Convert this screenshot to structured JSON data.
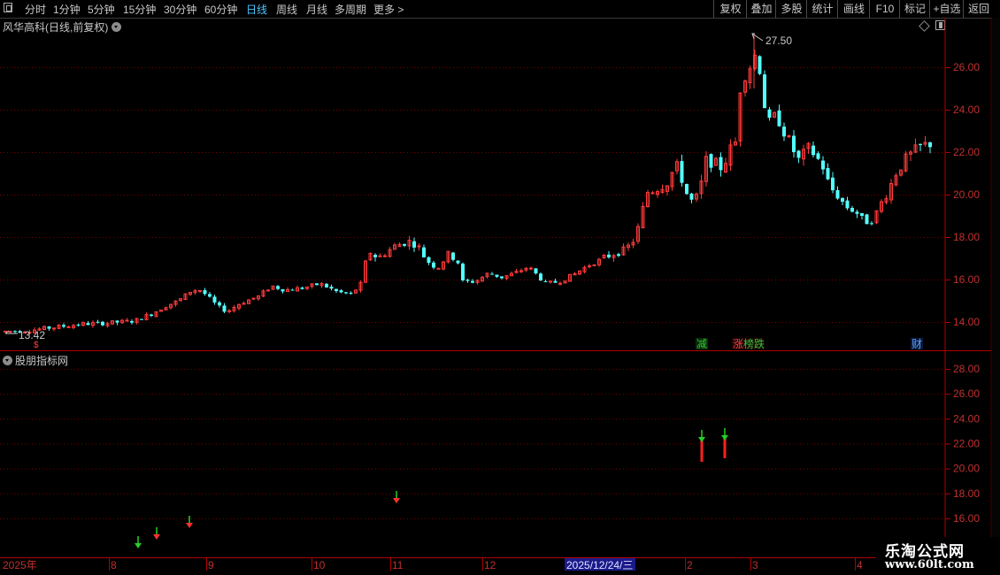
{
  "toolbar": {
    "periods": [
      "分时",
      "1分钟",
      "5分钟",
      "15分钟",
      "30分钟",
      "60分钟",
      "日线",
      "周线",
      "月线",
      "多周期",
      "更多 >"
    ],
    "active_period": "日线",
    "buttons": [
      "复权",
      "叠加",
      "多股",
      "统计",
      "画线",
      "F10",
      "标记",
      "+自选",
      "返回"
    ]
  },
  "main_chart": {
    "title": "风华高科(日线,前复权)",
    "high_label": "27.50",
    "low_label": "13.42",
    "axis_ticks": [
      "26.00",
      "24.00",
      "22.00",
      "20.00",
      "18.00",
      "16.00",
      "14.00"
    ],
    "event_markers": [
      {
        "text": "减",
        "color": "#35c435"
      },
      {
        "text": "涨",
        "color": "#ff4040"
      },
      {
        "text": "榜",
        "color": "#35c435"
      },
      {
        "text": "跌",
        "color": "#35c435"
      },
      {
        "text": "财",
        "color": "#5aa0ff"
      }
    ],
    "small_marker": "$"
  },
  "indicator_panel": {
    "title": "股朋指标网",
    "axis_ticks": [
      "28.00",
      "26.00",
      "24.00",
      "22.00",
      "20.00",
      "18.00",
      "16.00"
    ]
  },
  "time_axis": {
    "labels": [
      "2025年",
      "8",
      "9",
      "10",
      "11",
      "12",
      "2025/12/24/三",
      "2",
      "3",
      "4"
    ],
    "highlight": "2025/12/24/三"
  },
  "watermark": {
    "line1": "乐淘公式网",
    "line2": "www.60lt.com"
  },
  "colors": {
    "up": "#ff3a3a",
    "down": "#54ffff",
    "grid": "#7a0000",
    "axis": "#b00000",
    "arrow_green": "#25d025"
  },
  "chart_data": {
    "type": "candlestick",
    "ylim": [
      12.8,
      28.0
    ],
    "candles": [
      [
        13.5,
        13.62,
        13.58,
        13.46
      ],
      [
        13.55,
        13.66,
        13.6,
        13.52
      ],
      [
        13.58,
        13.7,
        13.62,
        13.55
      ],
      [
        13.62,
        13.74,
        13.66,
        13.58
      ],
      [
        13.66,
        13.78,
        13.7,
        13.62
      ],
      [
        13.7,
        13.82,
        13.74,
        13.66
      ],
      [
        13.74,
        13.86,
        13.78,
        13.7
      ],
      [
        13.78,
        13.9,
        13.82,
        13.74
      ],
      [
        13.82,
        13.94,
        13.86,
        13.78
      ],
      [
        13.86,
        13.98,
        13.9,
        13.82
      ],
      [
        13.9,
        14.02,
        13.94,
        13.86
      ],
      [
        13.94,
        14.06,
        13.98,
        13.9
      ],
      [
        13.98,
        14.1,
        14.02,
        13.94
      ],
      [
        14.02,
        14.14,
        14.06,
        13.98
      ],
      [
        14.06,
        14.18,
        14.1,
        14.02
      ],
      [
        14.1,
        14.22,
        14.14,
        14.06
      ],
      [
        14.14,
        14.26,
        14.18,
        14.1
      ],
      [
        14.18,
        14.3,
        14.22,
        14.14
      ],
      [
        14.22,
        14.34,
        14.26,
        14.18
      ],
      [
        14.26,
        14.38,
        14.3,
        14.22
      ],
      [
        14.3,
        14.42,
        14.34,
        14.26
      ],
      [
        14.34,
        14.46,
        14.38,
        14.3
      ],
      [
        14.38,
        14.5,
        14.42,
        14.34
      ],
      [
        14.42,
        14.54,
        14.46,
        14.38
      ],
      [
        14.46,
        14.58,
        14.5,
        14.42
      ],
      [
        14.5,
        14.62,
        14.54,
        14.46
      ],
      [
        14.54,
        14.66,
        14.58,
        14.5
      ],
      [
        14.58,
        14.7,
        14.62,
        14.54
      ],
      [
        14.62,
        14.74,
        14.66,
        14.58
      ],
      [
        14.66,
        14.78,
        14.7,
        14.62
      ],
      [
        14.7,
        14.82,
        14.74,
        14.66
      ],
      [
        14.74,
        14.86,
        14.78,
        14.7
      ],
      [
        14.78,
        14.9,
        14.82,
        14.74
      ],
      [
        14.82,
        14.94,
        14.86,
        14.78
      ],
      [
        14.86,
        14.98,
        14.9,
        14.82
      ],
      [
        14.9,
        15.02,
        14.94,
        14.86
      ]
    ],
    "indicator_signals": [
      {
        "date": "2025-08",
        "value": 16.2,
        "arrow": "down"
      },
      {
        "date": "2025-08",
        "value": 16.4,
        "arrow": "up"
      },
      {
        "date": "2025-08",
        "value": 16.4,
        "arrow": "up"
      },
      {
        "date": "2025-11",
        "value": 17.5,
        "arrow": "up"
      },
      {
        "date": "2026-02",
        "value": 22.5,
        "arrow": "up"
      },
      {
        "date": "2026-02",
        "value": 22.6,
        "arrow": "up"
      }
    ]
  }
}
